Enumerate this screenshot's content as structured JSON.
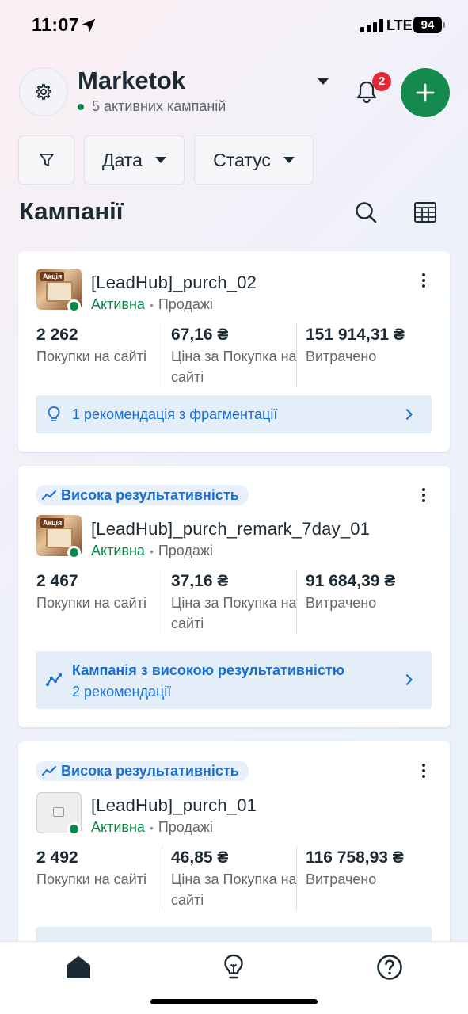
{
  "status_bar": {
    "time": "11:07",
    "network": "LTE",
    "battery": "94"
  },
  "header": {
    "account_name": "Marketok",
    "account_subtitle": "5 активних кампаній",
    "notification_count": "2"
  },
  "filters": {
    "date_label": "Дата",
    "status_label": "Статус"
  },
  "section": {
    "title": "Кампанії"
  },
  "campaigns": [
    {
      "name": "[LeadHub]_purch_02",
      "status": "Активна",
      "objective": "Продажі",
      "metrics": [
        {
          "value": "2 262",
          "label": "Покупки на сайті"
        },
        {
          "value": "67,16 ₴",
          "label": "Ціна за Покупка на сайті"
        },
        {
          "value": "151 914,31 ₴",
          "label": "Витрачено"
        }
      ],
      "recommendation": {
        "text": "1 рекомендація з фрагментації"
      }
    },
    {
      "badge": "Висока результативність",
      "name": "[LeadHub]_purch_remark_7day_01",
      "status": "Активна",
      "objective": "Продажі",
      "metrics": [
        {
          "value": "2 467",
          "label": "Покупки на сайті"
        },
        {
          "value": "37,16 ₴",
          "label": "Ціна за Покупка на сайті"
        },
        {
          "value": "91 684,39 ₴",
          "label": "Витрачено"
        }
      ],
      "recommendation": {
        "title": "Кампанія з високою результативністю",
        "text": "2 рекомендації"
      }
    },
    {
      "badge": "Висока результативність",
      "name": "[LeadHub]_purch_01",
      "status": "Активна",
      "objective": "Продажі",
      "metrics": [
        {
          "value": "2 492",
          "label": "Покупки на сайті"
        },
        {
          "value": "46,85 ₴",
          "label": "Ціна за Покупка на сайті"
        },
        {
          "value": "116 758,93 ₴",
          "label": "Витрачено"
        }
      ]
    }
  ],
  "thumbnail_promo_text": "Акція",
  "colors": {
    "brand_green": "#148a4e",
    "accent_blue": "#1a6ed2",
    "badge_red": "#e0293b"
  }
}
